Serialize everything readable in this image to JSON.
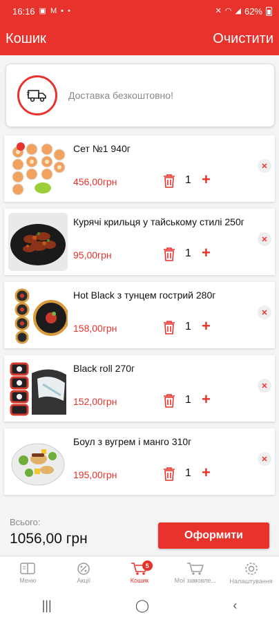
{
  "status_bar": {
    "time": "16:16",
    "battery": "62%"
  },
  "app_bar": {
    "title": "Кошик",
    "clear_label": "Очистити"
  },
  "delivery": {
    "text": "Доставка безкоштовно!"
  },
  "cart_items": [
    {
      "name": "Сет №1 940г",
      "price": "456,00грн",
      "qty": "1"
    },
    {
      "name": "Курячі крильця у тайському стилі 250г",
      "price": "95,00грн",
      "qty": "1"
    },
    {
      "name": "Hot Black з тунцем гострий 280г",
      "price": "158,00грн",
      "qty": "1"
    },
    {
      "name": "Black roll  270г",
      "price": "152,00грн",
      "qty": "1"
    },
    {
      "name": "Боул з вугрем і манго 310г",
      "price": "195,00грн",
      "qty": "1"
    }
  ],
  "total": {
    "label": "Всього:",
    "value": "1056,00 грн",
    "checkout_label": "Оформити"
  },
  "bottom_nav": [
    {
      "label": "Меню",
      "icon": "menu-book-icon"
    },
    {
      "label": "Акції",
      "icon": "percent-icon"
    },
    {
      "label": "Кошик",
      "icon": "cart-icon",
      "badge": "5",
      "active": true
    },
    {
      "label": "Мої замовле...",
      "icon": "cart-arrow-icon"
    },
    {
      "label": "Налаштування",
      "icon": "gear-icon"
    }
  ],
  "colors": {
    "accent": "#e8322c"
  }
}
